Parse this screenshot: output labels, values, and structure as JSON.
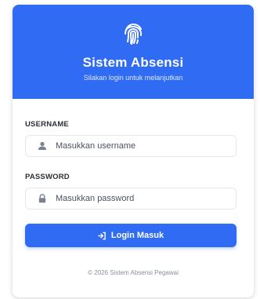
{
  "header": {
    "title": "Sistem Absensi",
    "subtitle": "Silakan login untuk melanjutkan",
    "logo_icon": "fingerprint-icon",
    "background_color": "#2f6cf3"
  },
  "form": {
    "username": {
      "label": "USERNAME",
      "placeholder": "Masukkan username",
      "value": "",
      "icon": "user-icon"
    },
    "password": {
      "label": "PASSWORD",
      "placeholder": "Masukkan password",
      "value": "",
      "icon": "lock-icon"
    },
    "submit": {
      "label": "Login Masuk",
      "icon": "sign-in-icon",
      "color": "#2f6cf3"
    }
  },
  "footer": {
    "text": "© 2026 Sistem Absensi Pegawai"
  }
}
